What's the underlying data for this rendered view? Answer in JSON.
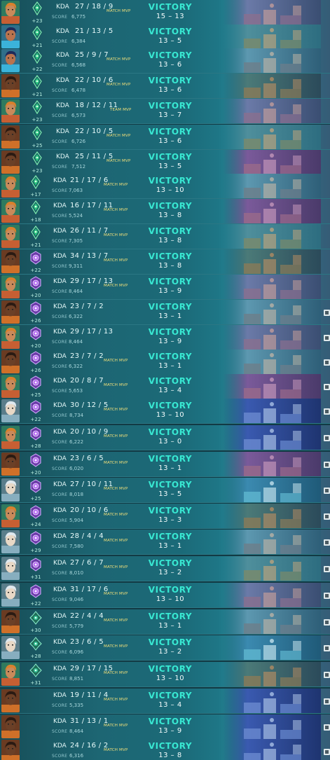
{
  "matches": [
    {
      "agent": "gekko",
      "rank": "emerald",
      "rr": "+23",
      "kda": "27 / 18 / 9",
      "score": "6,775",
      "mvp": "MATCH MVP",
      "result": "VICTORY",
      "final": "15 – 13",
      "map": "map-c",
      "badge": true,
      "edge": false
    },
    {
      "agent": "neon",
      "rank": "emerald",
      "rr": "+21",
      "kda": "21 / 13 / 5",
      "score": "6,384",
      "mvp": "",
      "result": "VICTORY",
      "final": "13 – 5",
      "map": "map-a",
      "badge": false,
      "edge": false
    },
    {
      "agent": "neon",
      "rank": "emerald",
      "rr": "+22",
      "kda": "25 / 9 / 7",
      "score": "6,568",
      "mvp": "MATCH MVP",
      "result": "VICTORY",
      "final": "13 – 6",
      "map": "map-b",
      "badge": false,
      "edge": false
    },
    {
      "agent": "phoenix",
      "rank": "emerald",
      "rr": "+21",
      "kda": "22 / 10 / 6",
      "score": "6,478",
      "mvp": "MATCH MVP",
      "result": "VICTORY",
      "final": "13 – 6",
      "map": "map-d",
      "badge": false,
      "edge": false
    },
    {
      "agent": "gekko",
      "rank": "emerald",
      "rr": "+23",
      "kda": "18 / 12 / 11",
      "score": "6,573",
      "mvp": "TEAM MVP",
      "result": "VICTORY",
      "final": "13 – 7",
      "map": "map-c",
      "badge": false,
      "edge": false
    },
    {
      "agent": "phoenix",
      "rank": "emerald",
      "rr": "+25",
      "kda": "22 / 10 / 5",
      "score": "6,726",
      "mvp": "MATCH MVP",
      "result": "VICTORY",
      "final": "13 – 6",
      "map": "map-a",
      "badge": true,
      "edge": false
    },
    {
      "agent": "phoenix",
      "rank": "emerald",
      "rr": "+23",
      "kda": "25 / 11 / 5",
      "score": "7,512",
      "mvp": "MATCH MVP",
      "result": "VICTORY",
      "final": "13 – 5",
      "map": "map-e",
      "badge": false,
      "edge": false
    },
    {
      "agent": "gekko",
      "rank": "emerald",
      "rr": "+17",
      "kda": "21 / 17 / 6",
      "score": "7,063",
      "mvp": "MATCH MVP",
      "result": "VICTORY",
      "final": "13 – 10",
      "map": "map-b",
      "badge": false,
      "edge": false
    },
    {
      "agent": "gekko",
      "rank": "emerald",
      "rr": "+18",
      "kda": "16 / 17 / 11",
      "score": "5,524",
      "mvp": "MATCH MVP",
      "result": "VICTORY",
      "final": "13 – 8",
      "map": "map-e",
      "badge": false,
      "edge": false
    },
    {
      "agent": "gekko",
      "rank": "emerald",
      "rr": "+21",
      "kda": "26 / 11 / 7",
      "score": "7,305",
      "mvp": "MATCH MVP",
      "result": "VICTORY",
      "final": "13 – 8",
      "map": "map-a",
      "badge": false,
      "edge": false
    },
    {
      "agent": "phoenix",
      "rank": "diamond",
      "rr": "+22",
      "kda": "34 / 13 / 7",
      "score": "9,311",
      "mvp": "MATCH MVP",
      "result": "VICTORY",
      "final": "13 – 8",
      "map": "map-d",
      "badge": true,
      "edge": false
    },
    {
      "agent": "gekko",
      "rank": "diamond",
      "rr": "+20",
      "kda": "29 / 17 / 13",
      "score": "8,464",
      "mvp": "MATCH MVP",
      "result": "VICTORY",
      "final": "13 – 9",
      "map": "map-c",
      "badge": false,
      "edge": false
    },
    {
      "agent": "phoenix",
      "rank": "diamond",
      "rr": "+26",
      "kda": "23 / 7 / 2",
      "score": "6,322",
      "mvp": "",
      "result": "VICTORY",
      "final": "13 – 1",
      "map": "map-b",
      "badge": false,
      "edge": true
    },
    {
      "agent": "gekko",
      "rank": "diamond",
      "rr": "+20",
      "kda": "29 / 17 / 13",
      "score": "8,464",
      "mvp": "",
      "result": "VICTORY",
      "final": "13 – 9",
      "map": "map-c",
      "badge": false,
      "edge": true
    },
    {
      "agent": "phoenix",
      "rank": "diamond",
      "rr": "+26",
      "kda": "23 / 7 / 2",
      "score": "6,322",
      "mvp": "MATCH MVP",
      "result": "VICTORY",
      "final": "13 – 1",
      "map": "map-b",
      "badge": false,
      "edge": true
    },
    {
      "agent": "gekko",
      "rank": "diamond",
      "rr": "+25",
      "kda": "20 / 8 / 7",
      "score": "5,653",
      "mvp": "MATCH MVP",
      "result": "VICTORY",
      "final": "13 – 4",
      "map": "map-e",
      "badge": false,
      "edge": true
    },
    {
      "agent": "sage",
      "rank": "diamond",
      "rr": "+22",
      "kda": "30 / 12 / 5",
      "score": "8,734",
      "mvp": "MATCH MVP",
      "result": "VICTORY",
      "final": "13 – 10",
      "map": "map-f",
      "badge": false,
      "edge": true
    },
    {
      "agent": "gekko",
      "rank": "diamond",
      "rr": "+28",
      "kda": "20 / 10 / 9",
      "score": "6,222",
      "mvp": "MATCH MVP",
      "result": "VICTORY",
      "final": "13 – 0",
      "map": "map-f",
      "badge": false,
      "edge": true
    },
    {
      "agent": "phoenix",
      "rank": "diamond",
      "rr": "+20",
      "kda": "23 / 6 / 5",
      "score": "6,020",
      "mvp": "MATCH MVP",
      "result": "VICTORY",
      "final": "13 – 1",
      "map": "map-e",
      "badge": false,
      "edge": true
    },
    {
      "agent": "sage",
      "rank": "diamond",
      "rr": "+25",
      "kda": "27 / 10 / 11",
      "score": "8,018",
      "mvp": "MATCH MVP",
      "result": "VICTORY",
      "final": "13 – 5",
      "map": "map-g",
      "badge": false,
      "edge": true
    },
    {
      "agent": "gekko",
      "rank": "diamond",
      "rr": "+24",
      "kda": "20 / 10 / 6",
      "score": "5,904",
      "mvp": "MATCH MVP",
      "result": "VICTORY",
      "final": "13 – 3",
      "map": "map-d",
      "badge": false,
      "edge": true
    },
    {
      "agent": "sage",
      "rank": "diamond",
      "rr": "+29",
      "kda": "28 / 4 / 4",
      "score": "7,580",
      "mvp": "MATCH MVP",
      "result": "VICTORY",
      "final": "13 – 1",
      "map": "map-b",
      "badge": false,
      "edge": true
    },
    {
      "agent": "sage",
      "rank": "diamond",
      "rr": "+31",
      "kda": "27 / 6 / 7",
      "score": "8,010",
      "mvp": "MATCH MVP",
      "result": "VICTORY",
      "final": "13 – 2",
      "map": "map-a",
      "badge": false,
      "edge": true
    },
    {
      "agent": "sage",
      "rank": "diamond",
      "rr": "+22",
      "kda": "31 / 17 / 6",
      "score": "9,046",
      "mvp": "MATCH MVP",
      "result": "VICTORY",
      "final": "13 – 10",
      "map": "map-c",
      "badge": false,
      "edge": true
    },
    {
      "agent": "phoenix",
      "rank": "ascendant",
      "rr": "+30",
      "kda": "22 / 4 / 4",
      "score": "5,779",
      "mvp": "MATCH MVP",
      "result": "VICTORY",
      "final": "13 – 1",
      "map": "map-b",
      "badge": true,
      "edge": true
    },
    {
      "agent": "sage",
      "rank": "ascendant",
      "rr": "+28",
      "kda": "23 / 6 / 5",
      "score": "6,096",
      "mvp": "MATCH MVP",
      "result": "VICTORY",
      "final": "13 – 2",
      "map": "map-g",
      "badge": false,
      "edge": true
    },
    {
      "agent": "gekko",
      "rank": "ascendant",
      "rr": "+31",
      "kda": "29 / 17 / 15",
      "score": "8,851",
      "mvp": "MATCH MVP",
      "result": "VICTORY",
      "final": "13 – 10",
      "map": "map-d",
      "badge": true,
      "edge": true
    },
    {
      "agent": "phoenix",
      "rank": "none",
      "rr": "",
      "kda": "19 / 11 / 4",
      "score": "5,335",
      "mvp": "MATCH MVP",
      "result": "VICTORY",
      "final": "13 – 4",
      "map": "map-f",
      "badge": false,
      "edge": true
    },
    {
      "agent": "phoenix",
      "rank": "none",
      "rr": "",
      "kda": "31 / 13 / 1",
      "score": "8,464",
      "mvp": "MATCH MVP",
      "result": "VICTORY",
      "final": "13 – 9",
      "map": "map-f",
      "badge": false,
      "edge": true
    },
    {
      "agent": "phoenix",
      "rank": "none",
      "rr": "",
      "kda": "24 / 16 / 2",
      "score": "6,316",
      "mvp": "MATCH MVP",
      "result": "VICTORY",
      "final": "13 – 8",
      "map": "map-f",
      "badge": false,
      "edge": true
    }
  ],
  "labels": {
    "kda": "KDA",
    "score": "SCORE"
  },
  "colors": {
    "victory": "#38e8d2",
    "mvp": "#f2e07a",
    "emerald": "#27c47c",
    "diamond": "#b46af0",
    "ascendant": "#39c89a"
  }
}
